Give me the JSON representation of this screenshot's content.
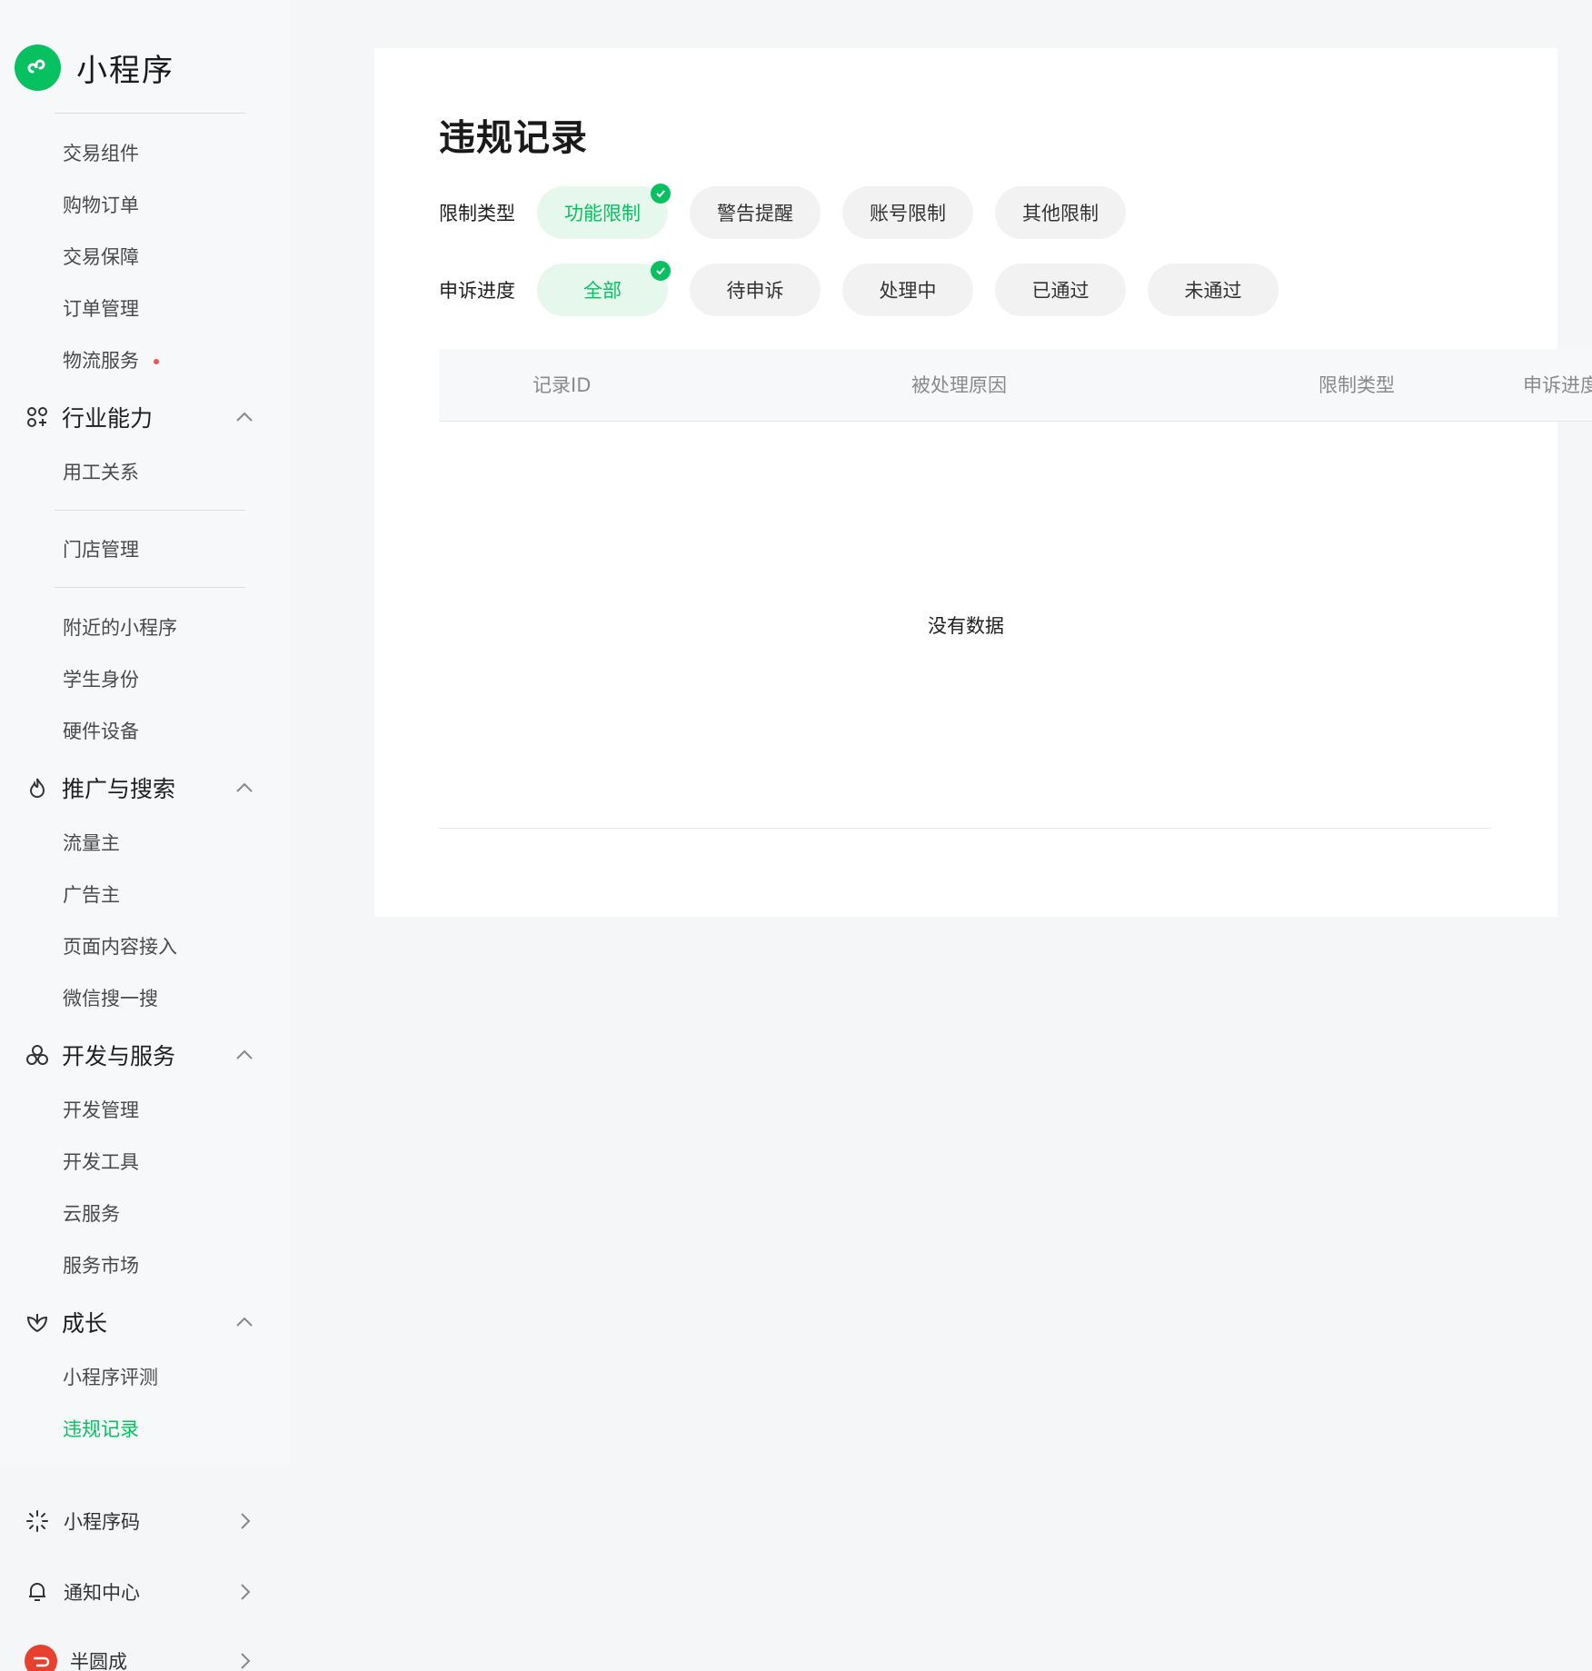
{
  "app": {
    "name": "小程序"
  },
  "colors": {
    "accent": "#07c160",
    "dot": "#fa5151",
    "avatar": "#e8402f"
  },
  "sidebar": {
    "items_a": [
      "交易组件",
      "购物订单",
      "交易保障",
      "订单管理",
      "物流服务"
    ],
    "group_industry": {
      "label": "行业能力",
      "icon": "industry-icon"
    },
    "industry_items": [
      "用工关系"
    ],
    "store": "门店管理",
    "items_b": [
      "附近的小程序",
      "学生身份",
      "硬件设备"
    ],
    "group_promo": {
      "label": "推广与搜索",
      "icon": "flame-icon"
    },
    "promo_items": [
      "流量主",
      "广告主",
      "页面内容接入",
      "微信搜一搜"
    ],
    "group_dev": {
      "label": "开发与服务",
      "icon": "dev-icon"
    },
    "dev_items": [
      "开发管理",
      "开发工具",
      "云服务",
      "服务市场"
    ],
    "group_growth": {
      "label": "成长",
      "icon": "growth-icon"
    },
    "growth_items": [
      "小程序评测",
      "违规记录"
    ],
    "bottom": [
      {
        "label": "小程序码",
        "icon": "qrcode-icon"
      },
      {
        "label": "通知中心",
        "icon": "bell-icon"
      },
      {
        "label": "半圆成",
        "icon": "avatar"
      }
    ]
  },
  "main": {
    "title": "违规记录",
    "filters": {
      "restriction": {
        "label": "限制类型",
        "options": [
          "功能限制",
          "警告提醒",
          "账号限制",
          "其他限制"
        ],
        "selected": "功能限制"
      },
      "appeal": {
        "label": "申诉进度",
        "options": [
          "全部",
          "待申诉",
          "处理中",
          "已通过",
          "未通过"
        ],
        "selected": "全部"
      }
    },
    "table": {
      "columns": [
        "记录ID",
        "被处理原因",
        "限制类型",
        "申诉进度"
      ],
      "rows": [],
      "empty_text": "没有数据"
    }
  }
}
